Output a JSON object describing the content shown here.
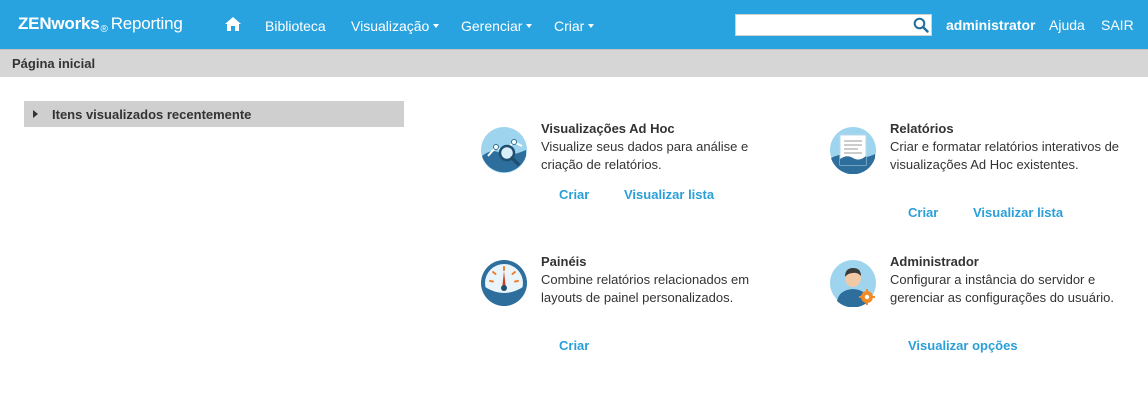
{
  "header": {
    "brand_name": "ZENworks",
    "brand_reg": "®",
    "brand_product": "Reporting",
    "home_icon": "home-icon",
    "nav": {
      "library": "Biblioteca",
      "view": "Visualização",
      "manage": "Gerenciar",
      "create": "Criar"
    },
    "search": {
      "value": "",
      "placeholder": ""
    },
    "username": "administrator",
    "help": "Ajuda",
    "logout": "SAIR"
  },
  "page_title": "Página inicial",
  "recent": {
    "label": "Itens visualizados recentemente"
  },
  "tiles": {
    "adhoc": {
      "title": "Visualizações Ad Hoc",
      "desc": "Visualize seus dados para análise e criação de relatórios.",
      "link_create": "Criar",
      "link_list": "Visualizar lista"
    },
    "reports": {
      "title": "Relatórios",
      "desc": "Criar e formatar relatórios interativos de visualizações Ad Hoc existentes.",
      "link_create": "Criar",
      "link_list": "Visualizar lista"
    },
    "dashboards": {
      "title": "Painéis",
      "desc": "Combine relatórios relacionados em layouts de painel personalizados.",
      "link_create": "Criar"
    },
    "admin": {
      "title": "Administrador",
      "desc": "Configurar a instância do servidor e gerenciar as configurações do usuário.",
      "link_options": "Visualizar opções"
    }
  },
  "colors": {
    "header_bg": "#29a3df",
    "title_bar_bg": "#d6d6d6",
    "link": "#2a9fd8",
    "icon_blue": "#2d6e9c"
  }
}
